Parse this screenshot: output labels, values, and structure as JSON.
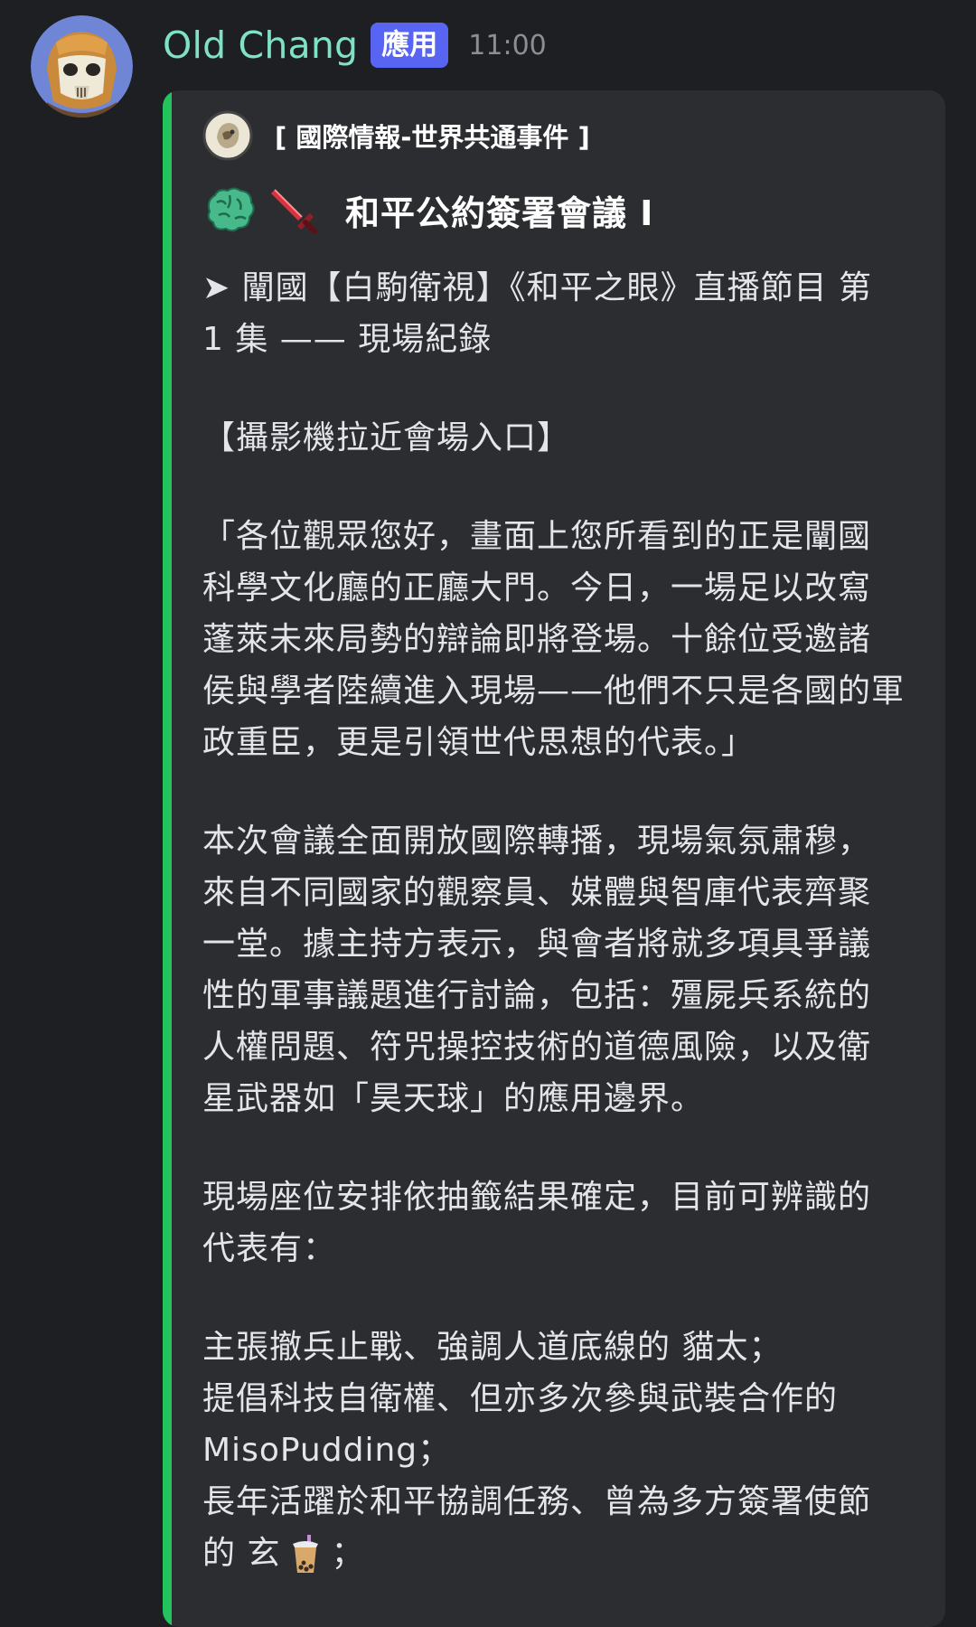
{
  "message": {
    "username": "Old Chang",
    "app_badge": "應用",
    "timestamp": "11:00",
    "colors": {
      "username": "#7ee3c6",
      "badge": "#5865f2",
      "embed_bar": "#23c45e",
      "embed_bg": "#2b2d31"
    }
  },
  "embed": {
    "author": "[ 國際情報-世界共通事件 ]",
    "title_icons": [
      "brain-icon",
      "sword-icon"
    ],
    "title": "和平公約簽署會議 I",
    "description": {
      "p1": [
        "➤ 闡國【白駒衛視】《和平之眼》直播節目 第",
        "1 集 —— 現場紀錄"
      ],
      "p2": [
        "【攝影機拉近會場入口】"
      ],
      "p3": [
        "「各位觀眾您好，畫面上您所看到的正是闡國",
        "科學文化廳的正廳大門。今日，一場足以改寫",
        "蓬萊未來局勢的辯論即將登場。十餘位受邀諸",
        "侯與學者陸續進入現場——他們不只是各國的軍",
        "政重臣，更是引領世代思想的代表。」"
      ],
      "p4": [
        "本次會議全面開放國際轉播，現場氣氛肅穆，",
        "來自不同國家的觀察員、媒體與智庫代表齊聚",
        "一堂。據主持方表示，與會者將就多項具爭議",
        "性的軍事議題進行討論，包括：殭屍兵系統的",
        "人權問題、符咒操控技術的道德風險，以及衛",
        "星武器如「昊天球」的應用邊界。"
      ],
      "p5": [
        "現場座位安排依抽籤結果確定，目前可辨識的",
        "代表有："
      ],
      "p6": [
        "主張撤兵止戰、強調人道底線的 貓太；",
        "提倡科技自衛權、但亦多次參與武裝合作的",
        "MisoPudding；",
        "長年活躍於和平協調任務、曾為多方簽署使節"
      ],
      "p6_last_before": "的 玄",
      "p6_last_after": "；",
      "p6_last_icon": "bubble-tea-icon"
    }
  }
}
